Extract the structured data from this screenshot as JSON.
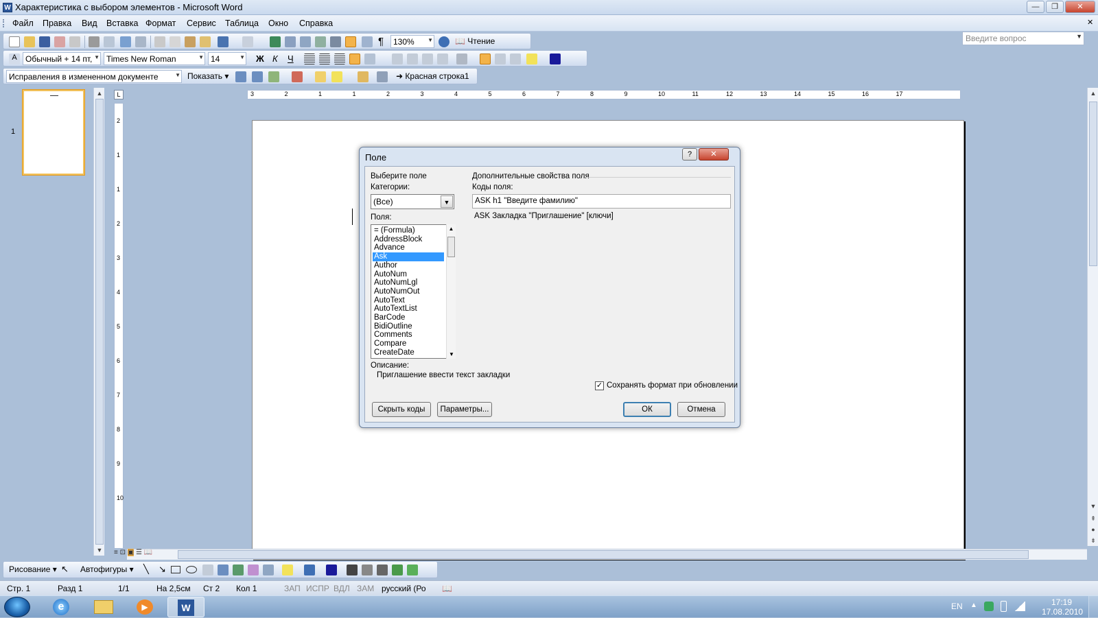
{
  "window": {
    "title": "Характеристика с выбором элементов - Microsoft Word"
  },
  "menu": {
    "items": [
      "Файл",
      "Правка",
      "Вид",
      "Вставка",
      "Формат",
      "Сервис",
      "Таблица",
      "Окно",
      "Справка"
    ]
  },
  "ask_placeholder": "Введите вопрос",
  "toolbar_standard": {
    "zoom": "130%",
    "reading": "Чтение"
  },
  "toolbar_format": {
    "style": "Обычный + 14 пт,",
    "font": "Times New Roman",
    "size": "14",
    "bold": "Ж",
    "italic": "К",
    "underline": "Ч"
  },
  "toolbar_review": {
    "mode": "Исправления в измененном документе",
    "show": "Показать",
    "style_name": "Красная строка1"
  },
  "thumbnail": {
    "page_number": "1"
  },
  "ruler": {
    "h_marks": [
      "3",
      "2",
      "1",
      "1",
      "2",
      "3",
      "4",
      "5",
      "6",
      "7",
      "8",
      "9",
      "10",
      "11",
      "12",
      "13",
      "14",
      "15",
      "16",
      "17"
    ],
    "v_marks": [
      "2",
      "1",
      "1",
      "2",
      "3",
      "4",
      "5",
      "6",
      "7",
      "8",
      "9",
      "10"
    ]
  },
  "dialog": {
    "title": "Поле",
    "help": "?",
    "left_heading": "Выберите поле",
    "categories_label": "Категории:",
    "categories_value": "(Все)",
    "fields_label": "Поля:",
    "fields": [
      "= (Formula)",
      "AddressBlock",
      "Advance",
      "Ask",
      "Author",
      "AutoNum",
      "AutoNumLgl",
      "AutoNumOut",
      "AutoText",
      "AutoTextList",
      "BarCode",
      "BidiOutline",
      "Comments",
      "Compare",
      "CreateDate"
    ],
    "selected_field": "Ask",
    "right_heading": "Дополнительные свойства поля",
    "codes_label": "Коды поля:",
    "codes_value": "ASK  h1 \"Введите фамилию\"",
    "syntax": "ASK Закладка \"Приглашение\" [ключи]",
    "description_label": "Описание:",
    "description": "Приглашение ввести текст закладки",
    "preserve_format": "Сохранять формат при обновлении",
    "preserve_checked": true,
    "hide_codes": "Скрыть коды",
    "options": "Параметры...",
    "ok": "ОК",
    "cancel": "Отмена"
  },
  "drawbar": {
    "drawing": "Рисование",
    "autoshapes": "Автофигуры"
  },
  "status": {
    "page": "Стр. 1",
    "section": "Разд 1",
    "pages": "1/1",
    "at": "На 2,5см",
    "line": "Ст 2",
    "col": "Кол 1",
    "rec": "ЗАП",
    "trk": "ИСПР",
    "ext": "ВДЛ",
    "ovr": "ЗАМ",
    "lang": "русский (Ро"
  },
  "taskbar": {
    "lang": "EN",
    "time": "17:19",
    "date": "17.08.2010"
  },
  "colors": {
    "selection": "#3399ff",
    "office_blue": "#abbfd8"
  }
}
